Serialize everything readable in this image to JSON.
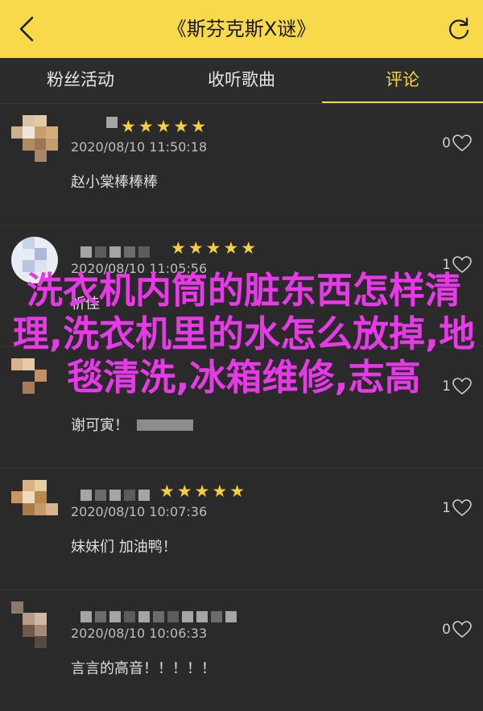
{
  "header": {
    "title": "《斯芬克斯Ⅹ谜》",
    "back_icon": "chevron-left-icon",
    "refresh_icon": "refresh-icon"
  },
  "tabs": [
    {
      "label": "粉丝活动",
      "active": false
    },
    {
      "label": "收听歌曲",
      "active": false
    },
    {
      "label": "评论",
      "active": true
    }
  ],
  "comments": [
    {
      "stars": "★★★★★",
      "timestamp": "2020/08/10 11:50:18",
      "likes": "0",
      "text": "赵小棠棒棒棒"
    },
    {
      "stars": "★★★★★",
      "timestamp": "2020/08/10 11:05:56",
      "likes": "1",
      "text": "祈佳"
    },
    {
      "stars": "★★★★★",
      "timestamp": "",
      "likes": "1",
      "text": "谢可寅！"
    },
    {
      "stars": "★★★★★",
      "timestamp": "2020/08/10 10:07:36",
      "likes": "1",
      "text": "妹妹们 加油鸭！"
    },
    {
      "stars": "",
      "timestamp": "2020/08/10 10:06:33",
      "likes": "0",
      "text": "言言的高音！！！！！"
    }
  ],
  "overlay_text": "洗衣机内筒的脏东西怎样清理,洗衣机里的水怎么放掉,地毯清洗,冰箱维修,志高",
  "colors": {
    "accent": "#f8d94a",
    "overlay": "#e839e8",
    "star": "#f5cf3d"
  }
}
